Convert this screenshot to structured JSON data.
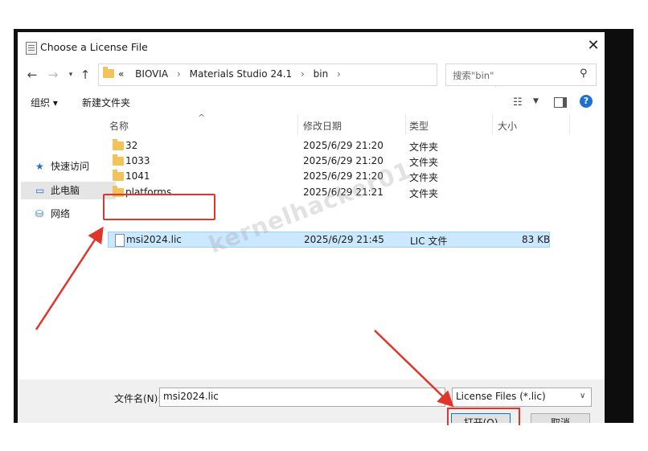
{
  "window": {
    "title": "Choose a License File"
  },
  "address": {
    "crumbs": [
      "«",
      "BIOVIA",
      "Materials Studio 24.1",
      "bin"
    ]
  },
  "search": {
    "placeholder": "搜索\"bin\""
  },
  "toolbar": {
    "organize": "组织 ▾",
    "new_folder": "新建文件夹"
  },
  "sidebar": {
    "items": [
      {
        "label": "快速访问",
        "icon": "star-icon"
      },
      {
        "label": "此电脑",
        "icon": "computer-icon"
      },
      {
        "label": "网络",
        "icon": "network-icon"
      }
    ]
  },
  "columns": {
    "name": "名称",
    "modified": "修改日期",
    "type": "类型",
    "size": "大小"
  },
  "files": [
    {
      "name": "32",
      "modified": "2025/6/29 21:20",
      "type": "文件夹",
      "size": "",
      "icon": "folder-icon"
    },
    {
      "name": "1033",
      "modified": "2025/6/29 21:20",
      "type": "文件夹",
      "size": "",
      "icon": "folder-icon"
    },
    {
      "name": "1041",
      "modified": "2025/6/29 21:20",
      "type": "文件夹",
      "size": "",
      "icon": "folder-icon"
    },
    {
      "name": "platforms",
      "modified": "2025/6/29 21:21",
      "type": "文件夹",
      "size": "",
      "icon": "folder-icon"
    },
    {
      "name": "msi2024.lic",
      "modified": "2025/6/29 21:45",
      "type": "LIC 文件",
      "size": "83 KB",
      "icon": "file-icon",
      "selected": true
    }
  ],
  "watermark": "kernelhacker01",
  "bottom": {
    "filename_label": "文件名(N):",
    "filename_value": "msi2024.lic",
    "filetype_value": "License Files (*.lic)",
    "open_label": "打开(O)",
    "cancel_label": "取消"
  },
  "colors": {
    "annotation": "#e0352b",
    "selection": "#cce8ff",
    "accent": "#0078d7"
  }
}
